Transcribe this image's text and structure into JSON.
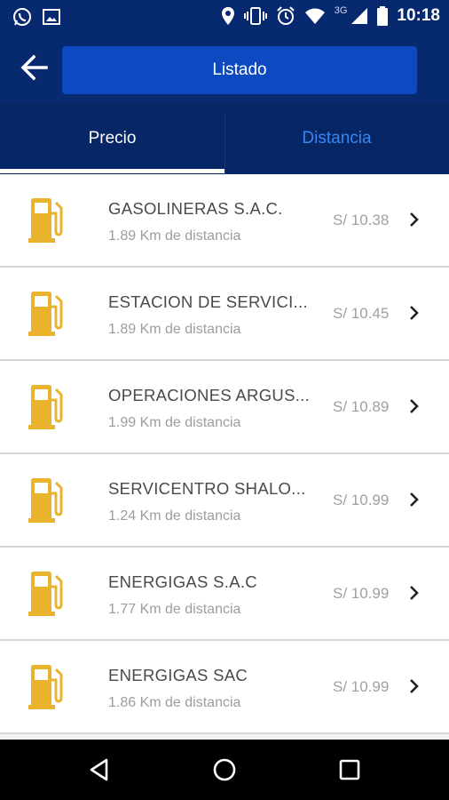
{
  "status_bar": {
    "time": "10:18",
    "network": "3G",
    "left_icons": [
      "whatsapp-icon",
      "gallery-icon"
    ],
    "right_icons": [
      "location-icon",
      "vibrate-icon",
      "alarm-icon",
      "wifi-icon",
      "signal-icon",
      "battery-icon"
    ]
  },
  "toolbar": {
    "title": "Listado",
    "back_icon": "arrow-left-icon"
  },
  "tabs": [
    {
      "label": "Precio",
      "active": true
    },
    {
      "label": "Distancia",
      "active": false
    }
  ],
  "colors": {
    "header_bg": "#07296f",
    "title_bg": "#0d49c1",
    "tab_inactive": "#3a86f0",
    "pump_icon": "#e9b32b"
  },
  "stations": [
    {
      "name": "GASOLINERAS  S.A.C.",
      "distance": "1.89 Km de distancia",
      "price": "S/ 10.38"
    },
    {
      "name": "ESTACION DE SERVICI...",
      "distance": "1.89 Km de distancia",
      "price": "S/ 10.45"
    },
    {
      "name": "OPERACIONES ARGUS...",
      "distance": "1.99 Km de distancia",
      "price": "S/ 10.89"
    },
    {
      "name": "SERVICENTRO SHALO...",
      "distance": "1.24 Km de distancia",
      "price": "S/ 10.99"
    },
    {
      "name": "ENERGIGAS S.A.C",
      "distance": "1.77 Km de distancia",
      "price": "S/ 10.99"
    },
    {
      "name": "ENERGIGAS SAC",
      "distance": "1.86 Km de distancia",
      "price": "S/ 10.99"
    }
  ],
  "nav_bar": [
    "back-triangle-icon",
    "home-circle-icon",
    "recents-square-icon"
  ]
}
